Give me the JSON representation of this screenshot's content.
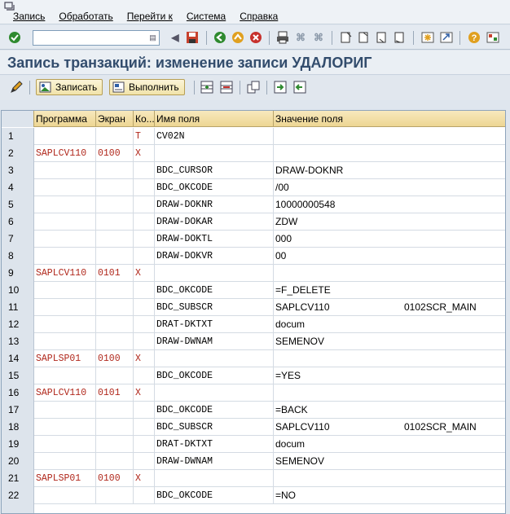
{
  "menu": {
    "items": [
      "Запись",
      "Обработать",
      "Перейти к",
      "Система",
      "Справка"
    ]
  },
  "toolbar": {
    "command_value": ""
  },
  "title": "Запись транзакций: изменение записи УДАЛОРИГ",
  "app_toolbar": {
    "record_label": "Записать",
    "execute_label": "Выполнить"
  },
  "table": {
    "headers": [
      "Программа",
      "Экран",
      "Ко...",
      "Имя поля",
      "Значение поля"
    ],
    "rows": [
      {
        "n": "1",
        "prog": "",
        "scr": "",
        "code": "T",
        "field": "CV02N",
        "val": "",
        "val2": ""
      },
      {
        "n": "2",
        "prog": "SAPLCV110",
        "scr": "0100",
        "code": "X",
        "field": "",
        "val": "",
        "val2": ""
      },
      {
        "n": "3",
        "prog": "",
        "scr": "",
        "code": "",
        "field": "BDC_CURSOR",
        "val": "DRAW-DOKNR",
        "val2": ""
      },
      {
        "n": "4",
        "prog": "",
        "scr": "",
        "code": "",
        "field": "BDC_OKCODE",
        "val": "/00",
        "val2": ""
      },
      {
        "n": "5",
        "prog": "",
        "scr": "",
        "code": "",
        "field": "DRAW-DOKNR",
        "val": "10000000548",
        "val2": ""
      },
      {
        "n": "6",
        "prog": "",
        "scr": "",
        "code": "",
        "field": "DRAW-DOKAR",
        "val": "ZDW",
        "val2": ""
      },
      {
        "n": "7",
        "prog": "",
        "scr": "",
        "code": "",
        "field": "DRAW-DOKTL",
        "val": "000",
        "val2": ""
      },
      {
        "n": "8",
        "prog": "",
        "scr": "",
        "code": "",
        "field": "DRAW-DOKVR",
        "val": "00",
        "val2": ""
      },
      {
        "n": "9",
        "prog": "SAPLCV110",
        "scr": "0101",
        "code": "X",
        "field": "",
        "val": "",
        "val2": ""
      },
      {
        "n": "10",
        "prog": "",
        "scr": "",
        "code": "",
        "field": "BDC_OKCODE",
        "val": "=F_DELETE",
        "val2": ""
      },
      {
        "n": "11",
        "prog": "",
        "scr": "",
        "code": "",
        "field": "BDC_SUBSCR",
        "val": "SAPLCV110",
        "val2": "0102SCR_MAIN"
      },
      {
        "n": "12",
        "prog": "",
        "scr": "",
        "code": "",
        "field": "DRAT-DKTXT",
        "val": "docum",
        "val2": ""
      },
      {
        "n": "13",
        "prog": "",
        "scr": "",
        "code": "",
        "field": "DRAW-DWNAM",
        "val": "SEMENOV",
        "val2": ""
      },
      {
        "n": "14",
        "prog": "SAPLSP01",
        "scr": "0100",
        "code": "X",
        "field": "",
        "val": "",
        "val2": ""
      },
      {
        "n": "15",
        "prog": "",
        "scr": "",
        "code": "",
        "field": "BDC_OKCODE",
        "val": "=YES",
        "val2": ""
      },
      {
        "n": "16",
        "prog": "SAPLCV110",
        "scr": "0101",
        "code": "X",
        "field": "",
        "val": "",
        "val2": ""
      },
      {
        "n": "17",
        "prog": "",
        "scr": "",
        "code": "",
        "field": "BDC_OKCODE",
        "val": "=BACK",
        "val2": ""
      },
      {
        "n": "18",
        "prog": "",
        "scr": "",
        "code": "",
        "field": "BDC_SUBSCR",
        "val": "SAPLCV110",
        "val2": "0102SCR_MAIN"
      },
      {
        "n": "19",
        "prog": "",
        "scr": "",
        "code": "",
        "field": "DRAT-DKTXT",
        "val": "docum",
        "val2": ""
      },
      {
        "n": "20",
        "prog": "",
        "scr": "",
        "code": "",
        "field": "DRAW-DWNAM",
        "val": "SEMENOV",
        "val2": ""
      },
      {
        "n": "21",
        "prog": "SAPLSP01",
        "scr": "0100",
        "code": "X",
        "field": "",
        "val": "",
        "val2": ""
      },
      {
        "n": "22",
        "prog": "",
        "scr": "",
        "code": "",
        "field": "BDC_OKCODE",
        "val": "=NO",
        "val2": ""
      }
    ]
  }
}
